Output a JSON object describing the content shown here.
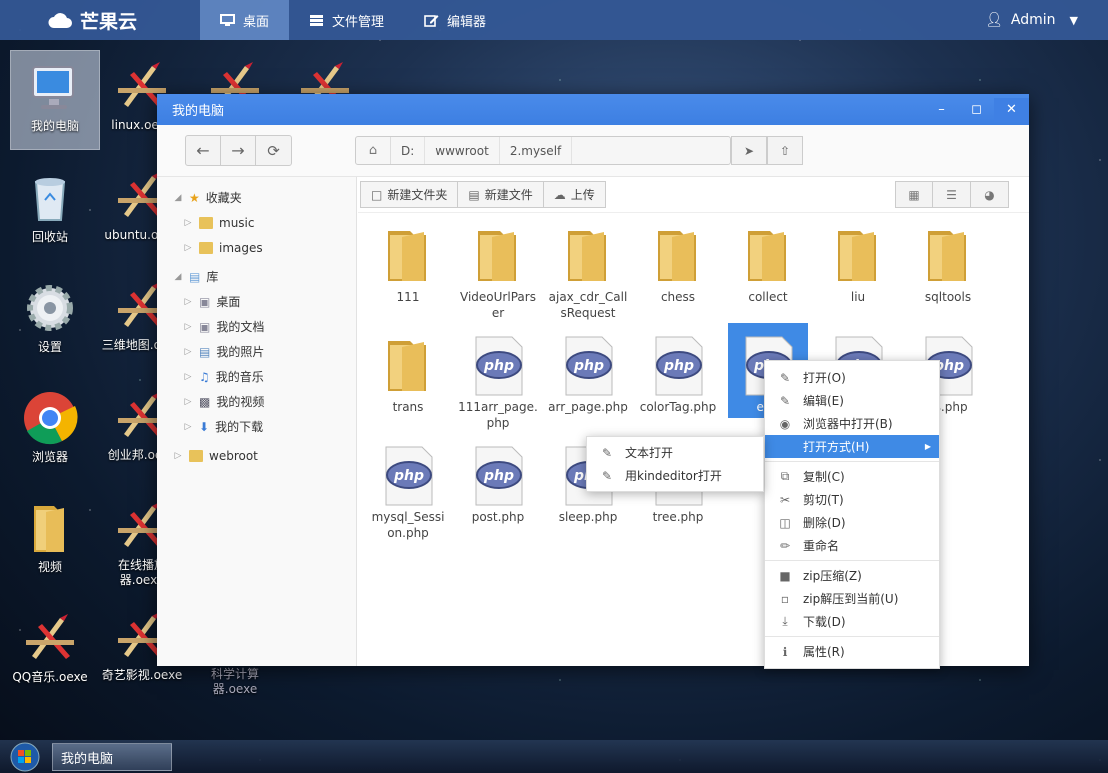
{
  "topbar": {
    "brand": "芒果云",
    "nav": [
      {
        "label": "桌面",
        "active": true
      },
      {
        "label": "文件管理",
        "active": false
      },
      {
        "label": "编辑器",
        "active": false
      }
    ],
    "user": "Admin"
  },
  "desktop": {
    "icons": [
      {
        "label": "我的电脑",
        "icon": "computer-icon"
      },
      {
        "label": "linux.oexe",
        "icon": "app-icon"
      },
      {
        "label": "回收站",
        "icon": "recycle-bin-icon"
      },
      {
        "label": "ubuntu.oexe",
        "icon": "app-icon"
      },
      {
        "label": "设置",
        "icon": "gear-icon"
      },
      {
        "label": "三维地图.oexe",
        "icon": "app-icon"
      },
      {
        "label": "浏览器",
        "icon": "chrome-icon"
      },
      {
        "label": "创业邦.oexe",
        "icon": "app-icon"
      },
      {
        "label": "视频",
        "icon": "folder-icon"
      },
      {
        "label": "在线播放器.oexe",
        "icon": "app-icon"
      },
      {
        "label": "QQ音乐.oexe",
        "icon": "app-icon"
      },
      {
        "label": "奇艺影视.oexe",
        "icon": "app-icon"
      },
      {
        "label": "科学计算器.oexe",
        "icon": "app-icon"
      }
    ]
  },
  "window": {
    "title": "我的电脑",
    "controls": [
      "–",
      "◻",
      "✕"
    ],
    "path": [
      "D:",
      "wwwroot",
      "2.myself"
    ],
    "sidebar": {
      "favorites": "收藏夹",
      "fav_items": [
        "music",
        "images"
      ],
      "library": "库",
      "lib_items": [
        "桌面",
        "我的文档",
        "我的照片",
        "我的音乐",
        "我的视频",
        "我的下载"
      ],
      "webroot": "webroot"
    },
    "toolbar": {
      "new_folder": "新建文件夹",
      "new_file": "新建文件",
      "upload": "上传"
    },
    "files": [
      {
        "name": "111",
        "type": "folder"
      },
      {
        "name": "VideoUrlParser",
        "type": "folder"
      },
      {
        "name": "ajax_cdr_CallsRequest",
        "type": "folder"
      },
      {
        "name": "chess",
        "type": "folder"
      },
      {
        "name": "collect",
        "type": "folder"
      },
      {
        "name": "liu",
        "type": "folder"
      },
      {
        "name": "sqltools",
        "type": "folder"
      },
      {
        "name": "trans",
        "type": "folder"
      },
      {
        "name": "111arr_page.php",
        "type": "php"
      },
      {
        "name": "arr_page.php",
        "type": "php"
      },
      {
        "name": "colorTag.php",
        "type": "php"
      },
      {
        "name": "eidt",
        "type": "php",
        "selected": true
      },
      {
        "name": "",
        "type": "php"
      },
      {
        "name": "ss.php",
        "type": "php"
      },
      {
        "name": "mysql_Session.php",
        "type": "php"
      },
      {
        "name": "post.php",
        "type": "php"
      },
      {
        "name": "sleep.php",
        "type": "php"
      },
      {
        "name": "tree.php",
        "type": "php"
      }
    ]
  },
  "context_menu": {
    "items": [
      {
        "label": "打开(O)",
        "icon": "edit-icon"
      },
      {
        "label": "编辑(E)",
        "icon": "edit-icon"
      },
      {
        "label": "浏览器中打开(B)",
        "icon": "globe-icon"
      },
      {
        "label": "打开方式(H)",
        "icon": "",
        "highlight": true,
        "submenu": true
      },
      {
        "label": "复制(C)",
        "icon": "copy-icon",
        "sep": true
      },
      {
        "label": "剪切(T)",
        "icon": "scissors-icon"
      },
      {
        "label": "删除(D)",
        "icon": "trash-icon"
      },
      {
        "label": "重命名",
        "icon": "pencil-icon"
      },
      {
        "label": "zip压缩(Z)",
        "icon": "folder-icon",
        "sep": true
      },
      {
        "label": "zip解压到当前(U)",
        "icon": "folder-open-icon"
      },
      {
        "label": "下载(D)",
        "icon": "download-icon"
      },
      {
        "label": "属性(R)",
        "icon": "info-icon",
        "sep": true
      }
    ]
  },
  "submenu": {
    "items": [
      "文本打开",
      "用kindeditor打开"
    ]
  },
  "taskbar": {
    "task": "我的电脑"
  }
}
